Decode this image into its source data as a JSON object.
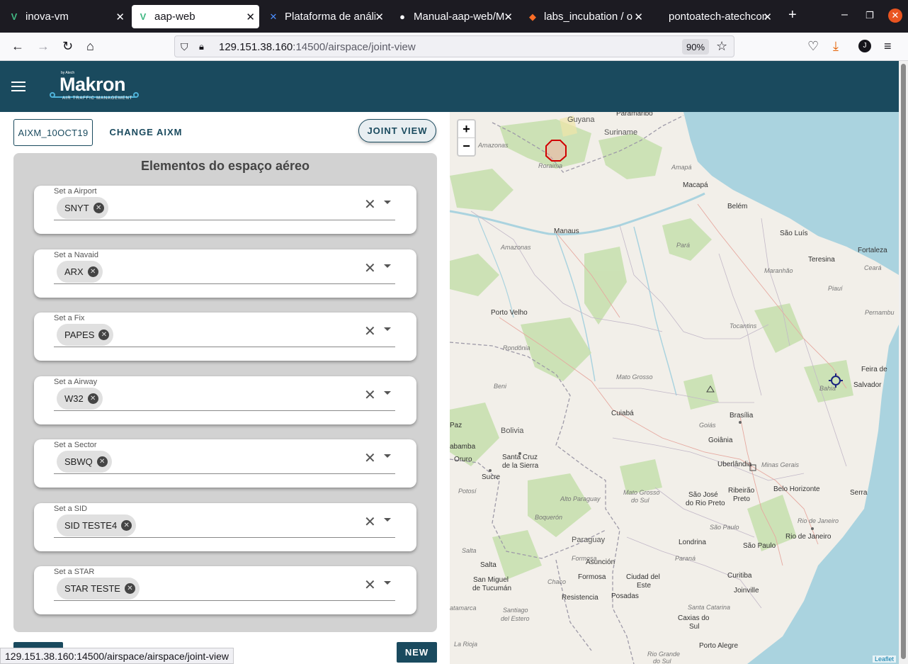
{
  "browser": {
    "tabs": [
      {
        "label": "inova-vm",
        "icon": "vue-icon"
      },
      {
        "label": "aap-web",
        "icon": "vue-icon"
      },
      {
        "label": "Plataforma de análise",
        "icon": "confluence-icon"
      },
      {
        "label": "Manual-aap-web/M",
        "icon": "github-icon"
      },
      {
        "label": "labs_incubation / o",
        "icon": "gitlab-icon"
      },
      {
        "label": "pontoatech-atechcom",
        "icon": "page-icon"
      }
    ],
    "url_host": "129.151.38.160",
    "url_path": ":14500/airspace/joint-view",
    "zoom": "90%",
    "status_url": "129.151.38.160:14500/airspace/airspace/joint-view"
  },
  "app": {
    "logo_by": "by Atech",
    "logo_name": "Makron",
    "logo_sub": "AIR TRAFFIC MANAGEMENT"
  },
  "toolbar": {
    "aixm_label": "AIXM_10OCT19",
    "change_label": "CHANGE AIXM",
    "joint_label": "JOINT VIEW"
  },
  "panel": {
    "title": "Elementos do espaço aéreo",
    "fields": [
      {
        "label": "Set a Airport",
        "chip": "SNYT"
      },
      {
        "label": "Set a Navaid",
        "chip": "ARX"
      },
      {
        "label": "Set a Fix",
        "chip": "PAPES"
      },
      {
        "label": "Set a Airway",
        "chip": "W32"
      },
      {
        "label": "Set a Sector",
        "chip": "SBWQ"
      },
      {
        "label": "Set a SID",
        "chip": "SID TESTE4"
      },
      {
        "label": "Set a STAR",
        "chip": "STAR TESTE"
      }
    ],
    "new_label": "NEW"
  },
  "map": {
    "zoom_in": "+",
    "zoom_out": "−",
    "attribution": "Leaflet",
    "colors": {
      "land": "#f2efe9",
      "water": "#aad3df",
      "forest": "#c8e0b0",
      "border": "#9e9aa8",
      "marker": "#d00000",
      "navaid": "#1a237e"
    },
    "labels": {
      "guyana": "Guyana",
      "suriname": "Suriname",
      "paramaribo": "Paramaribo",
      "roraima": "Roraima",
      "amapa": "Amapá",
      "macapa": "Macapá",
      "belem": "Belém",
      "manaus": "Manaus",
      "amazonas": "Amazonas",
      "amazonas_w": "Amazonas",
      "para": "Pará",
      "sao_luis": "São Luís",
      "fortaleza": "Fortaleza",
      "teresina": "Teresina",
      "maranhao": "Maranhão",
      "ceara": "Ceará",
      "piaui": "Piauí",
      "pernambu": "Pernambu",
      "porto_velho": "Porto Velho",
      "rondonia": "Rondônia",
      "tocantins": "Tocantins",
      "mato_grosso": "Mato Grosso",
      "beni": "Beni",
      "cuiaba": "Cuiabá",
      "brasilia": "Brasília",
      "bahia": "Bahia",
      "feira": "Feira de",
      "salvador": "Salvador",
      "bolivia": "Bolivia",
      "paz": "Paz",
      "goias": "Goiás",
      "goiania": "Goiânia",
      "uberlandia": "Uberlândia",
      "minas": "Minas Gerais",
      "santa_cruz": "Santa Cruz",
      "de_la_sierra": "de la Sierra",
      "bamba": "abamba",
      "oruro": "Oruro",
      "sucre": "Sucre",
      "potosi": "Potosí",
      "ms": "Mato Grosso",
      "ms2": "do Sul",
      "sao_jose": "São José",
      "rio_preto": "do Rio Preto",
      "ribeirao": "Ribeirão",
      "preto": "Preto",
      "belo_horizonte": "Belo Horizonte",
      "serra": "Serra",
      "alto_paraguay": "Alto Paraguay",
      "boqueron": "Boquerón",
      "paraguay": "Paraguay",
      "sao_paulo_st": "São Paulo",
      "rio_st": "Rio de Janeiro",
      "rio": "Rio de Janeiro",
      "londrina": "Londrina",
      "sao_paulo": "São Paulo",
      "parana": "Paraná",
      "salta": "Salta",
      "salta_city": "Salta",
      "asuncion": "Asunción",
      "formosa_st": "Formosa",
      "chaco": "Chaco",
      "formosa": "Formosa",
      "ciudad": "Ciudad del",
      "este": "Este",
      "curitiba": "Curitiba",
      "joinville": "Joinville",
      "san_miguel": "San Miguel",
      "tucuman": "de Tucumán",
      "resistencia": "Resistencia",
      "posadas": "Posadas",
      "santa_catarina": "Santa Catarina",
      "catamarca": "atamarca",
      "santiago": "Santiago",
      "del_estero": "del Estero",
      "caxias": "Caxias do",
      "sul": "Sul",
      "rioja": "La Rioja",
      "porto_alegre": "Porto Alegre",
      "rgs": "Rio Grande",
      "rgs2": "do Sul"
    }
  }
}
